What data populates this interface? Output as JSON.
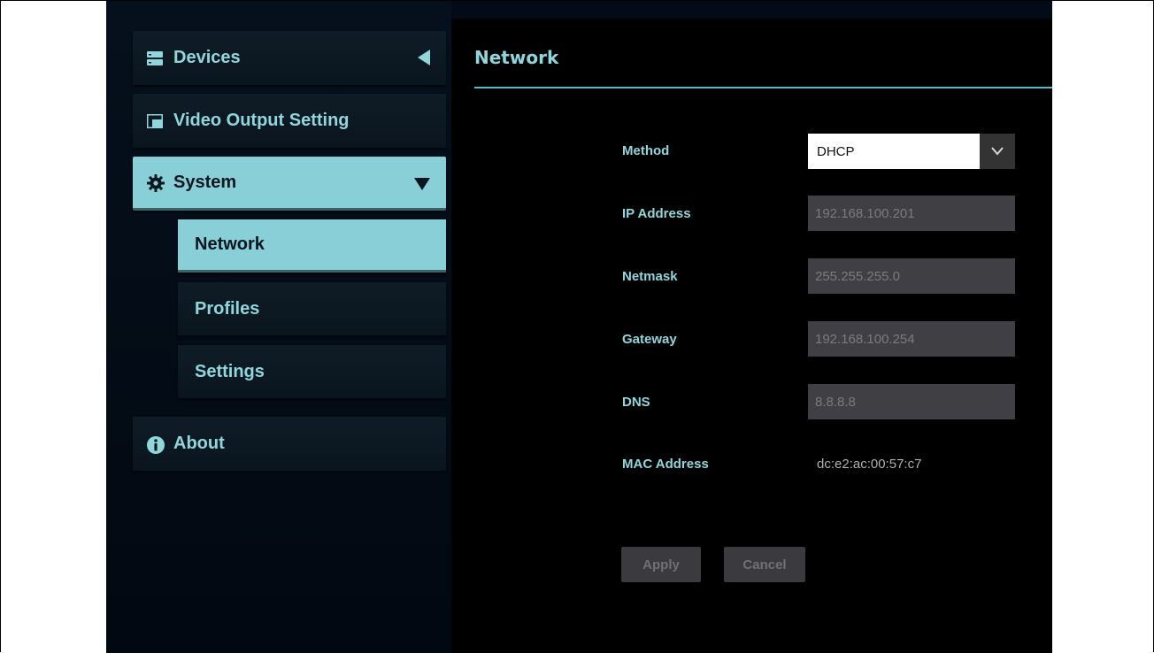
{
  "sidebar": {
    "items": [
      {
        "label": "Devices",
        "icon": "server-icon"
      },
      {
        "label": "Video Output Setting",
        "icon": "video-output-icon"
      },
      {
        "label": "System",
        "icon": "gear-icon"
      },
      {
        "label": "About",
        "icon": "info-icon"
      }
    ],
    "system_sub": [
      {
        "label": "Network"
      },
      {
        "label": "Profiles"
      },
      {
        "label": "Settings"
      }
    ]
  },
  "main": {
    "title": "Network",
    "form": {
      "method_label": "Method",
      "method_value": "DHCP",
      "ip_label": "IP Address",
      "ip_value": "192.168.100.201",
      "netmask_label": "Netmask",
      "netmask_value": "255.255.255.0",
      "gateway_label": "Gateway",
      "gateway_value": "192.168.100.254",
      "dns_label": "DNS",
      "dns_value": "8.8.8.8",
      "mac_label": "MAC Address",
      "mac_value": "dc:e2:ac:00:57:c7"
    },
    "buttons": {
      "apply": "Apply",
      "cancel": "Cancel"
    }
  },
  "colors": {
    "accent": "#89cfd8",
    "label": "#8fd6dd",
    "field_disabled": "#3f3f44"
  }
}
